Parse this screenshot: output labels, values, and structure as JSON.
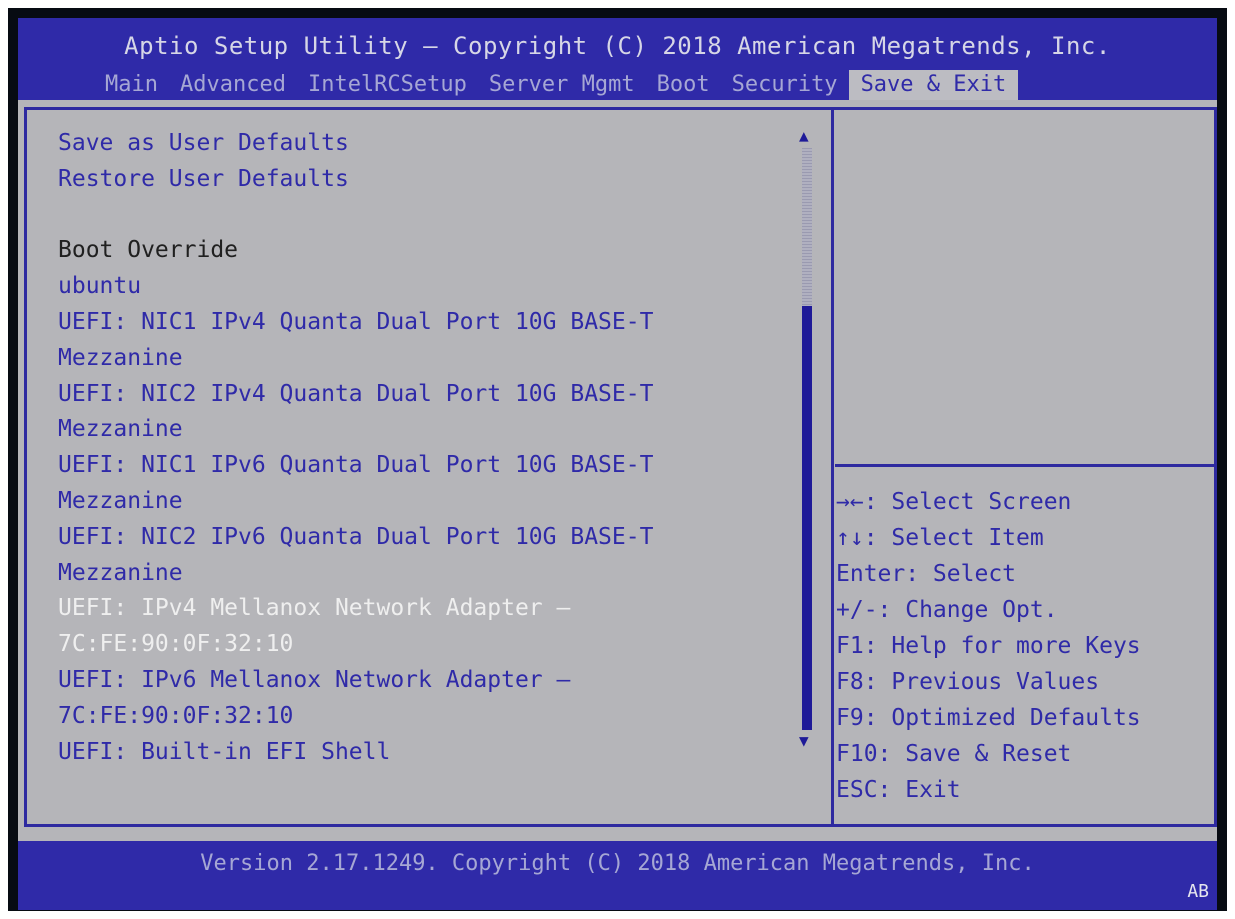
{
  "header": {
    "title": "Aptio Setup Utility – Copyright (C) 2018 American Megatrends, Inc.",
    "tabs": [
      {
        "label": "Main",
        "active": false
      },
      {
        "label": "Advanced",
        "active": false
      },
      {
        "label": "IntelRCSetup",
        "active": false
      },
      {
        "label": "Server Mgmt",
        "active": false
      },
      {
        "label": "Boot",
        "active": false
      },
      {
        "label": "Security",
        "active": false
      },
      {
        "label": "Save & Exit",
        "active": true
      }
    ]
  },
  "menu": {
    "items": [
      {
        "label": "Save as User Defaults",
        "style": "link"
      },
      {
        "label": "Restore User Defaults",
        "style": "link"
      },
      {
        "label": "",
        "style": "blank"
      },
      {
        "label": "Boot Override",
        "style": "heading"
      },
      {
        "label": "ubuntu",
        "style": "link"
      },
      {
        "label": "UEFI: NIC1 IPv4 Quanta Dual Port 10G BASE-T",
        "style": "link"
      },
      {
        "label": "Mezzanine",
        "style": "link"
      },
      {
        "label": "UEFI: NIC2 IPv4 Quanta Dual Port 10G BASE-T",
        "style": "link"
      },
      {
        "label": "Mezzanine",
        "style": "link"
      },
      {
        "label": "UEFI: NIC1 IPv6 Quanta Dual Port 10G BASE-T",
        "style": "link"
      },
      {
        "label": "Mezzanine",
        "style": "link"
      },
      {
        "label": "UEFI: NIC2 IPv6 Quanta Dual Port 10G BASE-T",
        "style": "link"
      },
      {
        "label": "Mezzanine",
        "style": "link"
      },
      {
        "label": "UEFI: IPv4 Mellanox Network Adapter –",
        "style": "highlight"
      },
      {
        "label": "7C:FE:90:0F:32:10",
        "style": "highlight"
      },
      {
        "label": "UEFI: IPv6 Mellanox Network Adapter –",
        "style": "link"
      },
      {
        "label": "7C:FE:90:0F:32:10",
        "style": "link"
      },
      {
        "label": "UEFI: Built-in EFI Shell",
        "style": "link"
      }
    ]
  },
  "scrollbar": {
    "up_glyph": "▲",
    "down_glyph": "▼",
    "position_fraction": 0.28
  },
  "help": {
    "lines": [
      "→←: Select Screen",
      "↑↓: Select Item",
      "Enter: Select",
      "+/-: Change Opt.",
      "F1: Help for more Keys",
      "F8: Previous Values",
      "F9: Optimized Defaults",
      "F10: Save & Reset",
      "ESC: Exit"
    ]
  },
  "footer": {
    "version": "Version 2.17.1249. Copyright (C) 2018 American Megatrends, Inc.",
    "code": "AB"
  },
  "colors": {
    "bar_blue": "#2f2aa8",
    "panel_gray": "#b5b5b9",
    "link_blue": "#2f2aa8",
    "highlight_white": "#efefef"
  }
}
